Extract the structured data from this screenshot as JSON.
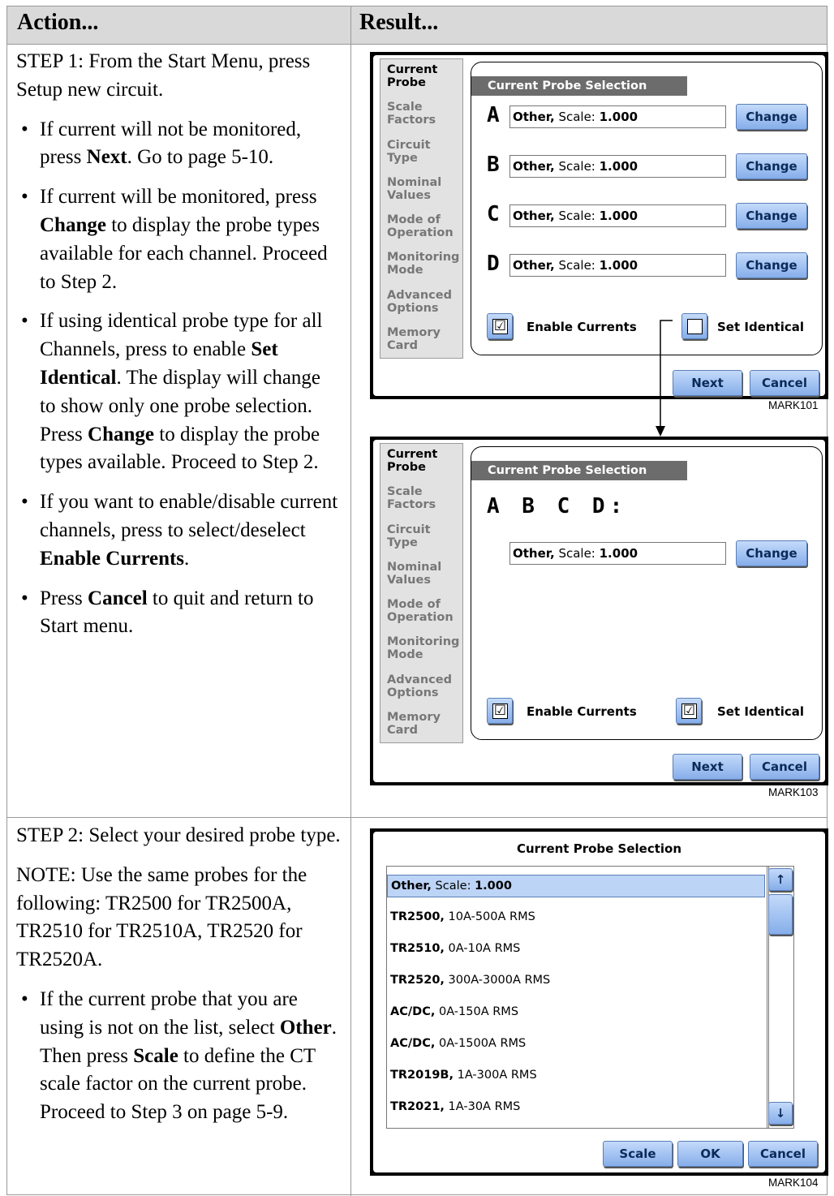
{
  "header": {
    "action": "Action...",
    "result": "Result..."
  },
  "step1": {
    "intro": "STEP 1: From the Start Menu, press Setup new circuit.",
    "bullets": [
      {
        "parts": [
          [
            "If current will not be monitored, press ",
            false
          ],
          [
            "Next",
            true
          ],
          [
            ". Go to page 5-10.",
            false
          ]
        ]
      },
      {
        "parts": [
          [
            "If current will be monitored, press ",
            false
          ],
          [
            "Change",
            true
          ],
          [
            " to display the probe types available for each channel. Proceed to Step 2.",
            false
          ]
        ]
      },
      {
        "parts": [
          [
            "If using identical probe type for all Channels, press to enable ",
            false
          ],
          [
            "Set Identical",
            true
          ],
          [
            ". The display will change to show only one probe selection. Press ",
            false
          ],
          [
            "Change",
            true
          ],
          [
            " to display the probe types available. Proceed to Step 2.",
            false
          ]
        ]
      },
      {
        "parts": [
          [
            "If you want to enable/disable current channels, press to select/deselect ",
            false
          ],
          [
            "Enable Currents",
            true
          ],
          [
            ".",
            false
          ]
        ]
      },
      {
        "parts": [
          [
            "Press ",
            false
          ],
          [
            "Cancel",
            true
          ],
          [
            " to quit and return to Start menu.",
            false
          ]
        ]
      }
    ]
  },
  "step2": {
    "intro": "STEP 2: Select your desired probe type.",
    "note": "NOTE: Use the same probes for the following: TR2500 for TR2500A, TR2510 for TR2510A, TR2520 for TR2520A.",
    "bullets": [
      {
        "parts": [
          [
            "If the current probe that you are using is not on the list, select ",
            false
          ],
          [
            "Other",
            true
          ],
          [
            ". Then press ",
            false
          ],
          [
            "Scale",
            true
          ],
          [
            " to define the CT scale factor on the current probe. Proceed to Step 3 on page 5-9.",
            false
          ]
        ]
      }
    ]
  },
  "sidebar": [
    "Current Probe",
    "Scale Factors",
    "Circuit Type",
    "Nominal Values",
    "Mode of Operation",
    "Monitoring Mode",
    "Advanced Options",
    "Memory Card"
  ],
  "screen1": {
    "title": "Current Probe Selection",
    "channels": [
      {
        "label": "A",
        "probe": "Other,",
        "scale_text": " Scale: ",
        "scale": "1.000"
      },
      {
        "label": "B",
        "probe": "Other,",
        "scale_text": " Scale: ",
        "scale": "1.000"
      },
      {
        "label": "C",
        "probe": "Other,",
        "scale_text": " Scale: ",
        "scale": "1.000"
      },
      {
        "label": "D",
        "probe": "Other,",
        "scale_text": " Scale: ",
        "scale": "1.000"
      }
    ],
    "change": "Change",
    "enable_currents": "Enable Currents",
    "set_identical": "Set Identical",
    "enable_checked": "☑",
    "identical_checked": "",
    "next": "Next",
    "cancel": "Cancel",
    "mark": "MARK101"
  },
  "screen2": {
    "title": "Current Probe Selection",
    "channel_label": "A B C D:",
    "probe": "Other,",
    "scale_text": " Scale: ",
    "scale": "1.000",
    "change": "Change",
    "enable_currents": "Enable Currents",
    "set_identical": "Set Identical",
    "next": "Next",
    "cancel": "Cancel",
    "mark": "MARK103"
  },
  "screen3": {
    "title": "Current Probe Selection",
    "items": [
      {
        "name": "Other,",
        "detail": " Scale: ",
        "bold_tail": "1.000",
        "selected": true
      },
      {
        "name": "TR2500,",
        "detail": " 10A-500A RMS",
        "bold_tail": ""
      },
      {
        "name": "TR2510,",
        "detail": " 0A-10A RMS",
        "bold_tail": ""
      },
      {
        "name": "TR2520,",
        "detail": " 300A-3000A RMS",
        "bold_tail": ""
      },
      {
        "name": "AC/DC,",
        "detail": " 0A-150A  RMS",
        "bold_tail": ""
      },
      {
        "name": "AC/DC,",
        "detail": " 0A-1500A RMS",
        "bold_tail": ""
      },
      {
        "name": "TR2019B,",
        "detail": " 1A-300A RMS",
        "bold_tail": ""
      },
      {
        "name": "TR2021,",
        "detail": " 1A-30A RMS",
        "bold_tail": ""
      }
    ],
    "up": "↑",
    "down": "↓",
    "scale": "Scale",
    "ok": "OK",
    "cancel": "Cancel",
    "mark": "MARK104"
  }
}
